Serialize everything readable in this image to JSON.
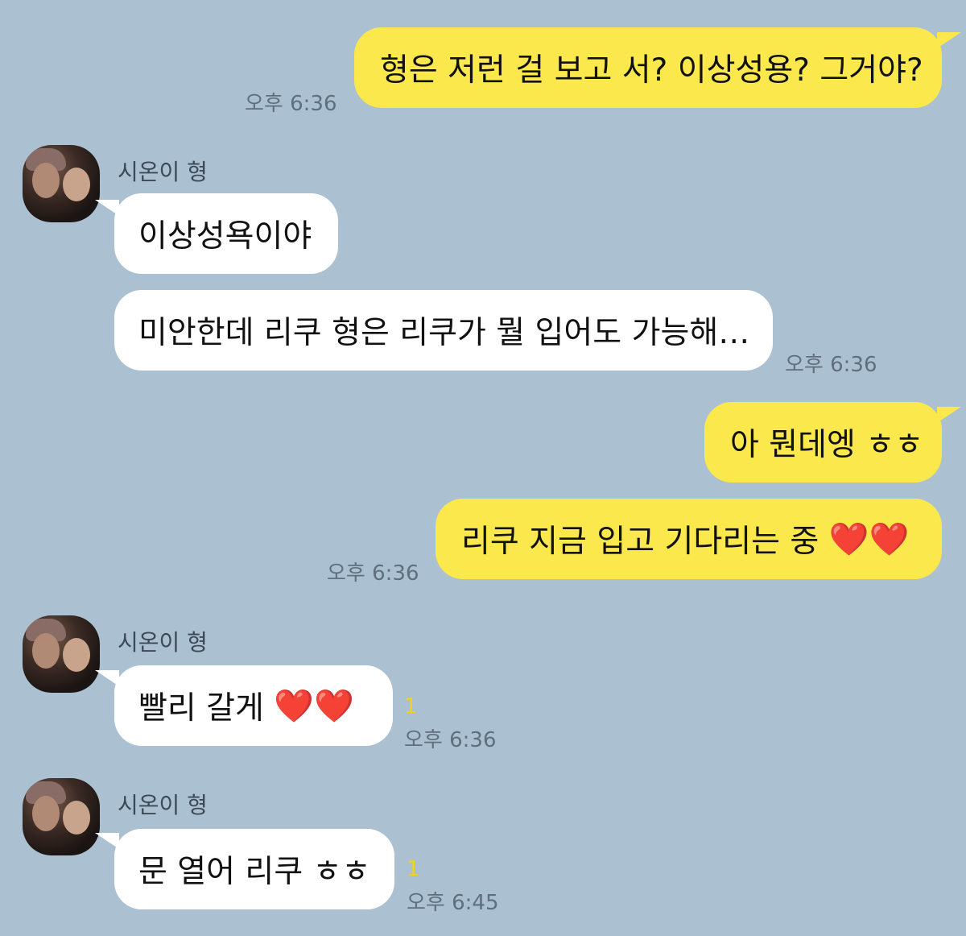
{
  "contact_name": "시온이 형",
  "messages": [
    {
      "id": "m1",
      "sender": "me",
      "text": "형은 저런 걸 보고 서? 이상성용? 그거야?",
      "time": "오후 6:36"
    },
    {
      "id": "m2",
      "sender": "them",
      "text": "이상성욕이야"
    },
    {
      "id": "m3",
      "sender": "them",
      "text": "미안한데 리쿠 형은 리쿠가 뭘 입어도 가능해…",
      "time": "오후 6:36"
    },
    {
      "id": "m4",
      "sender": "me",
      "text": "아 뭔데엥 ㅎㅎ"
    },
    {
      "id": "m5",
      "sender": "me",
      "text": "리쿠 지금 입고 기다리는 중",
      "emoji": "❤️❤️",
      "time": "오후 6:36"
    },
    {
      "id": "m6",
      "sender": "them",
      "text": "빨리 갈게",
      "emoji": "❤️❤️",
      "unread": "1",
      "time": "오후 6:36"
    },
    {
      "id": "m7",
      "sender": "them",
      "text": "문 열어 리쿠 ㅎㅎ",
      "unread": "1",
      "time": "오후 6:45"
    }
  ],
  "colors": {
    "background": "#abc0d1",
    "my_bubble": "#fbe84d",
    "their_bubble": "#ffffff",
    "unread": "#f2d21c"
  }
}
